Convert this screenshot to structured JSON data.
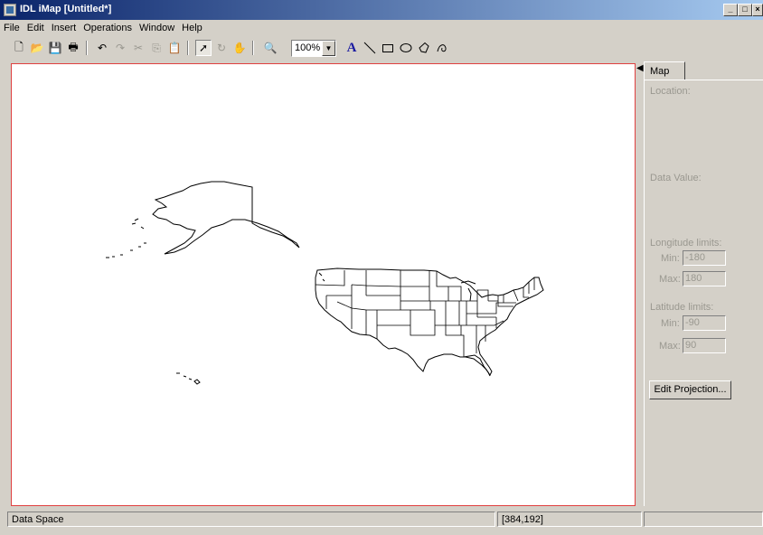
{
  "window": {
    "title": "IDL iMap [Untitled*]"
  },
  "menu": [
    "File",
    "Edit",
    "Insert",
    "Operations",
    "Window",
    "Help"
  ],
  "toolbar": {
    "zoom_value": "100%"
  },
  "panel": {
    "tab_label": "Map",
    "location_label": "Location:",
    "data_value_label": "Data Value:",
    "longitude_label": "Longitude limits:",
    "lon_min_label": "Min:",
    "lon_min": "-180",
    "lon_max_label": "Max:",
    "lon_max": "180",
    "latitude_label": "Latitude limits:",
    "lat_min_label": "Min:",
    "lat_min": "-90",
    "lat_max_label": "Max:",
    "lat_max": "90",
    "edit_projection_label": "Edit Projection..."
  },
  "status": {
    "mode": "Data Space",
    "coords": "[384,192]"
  }
}
